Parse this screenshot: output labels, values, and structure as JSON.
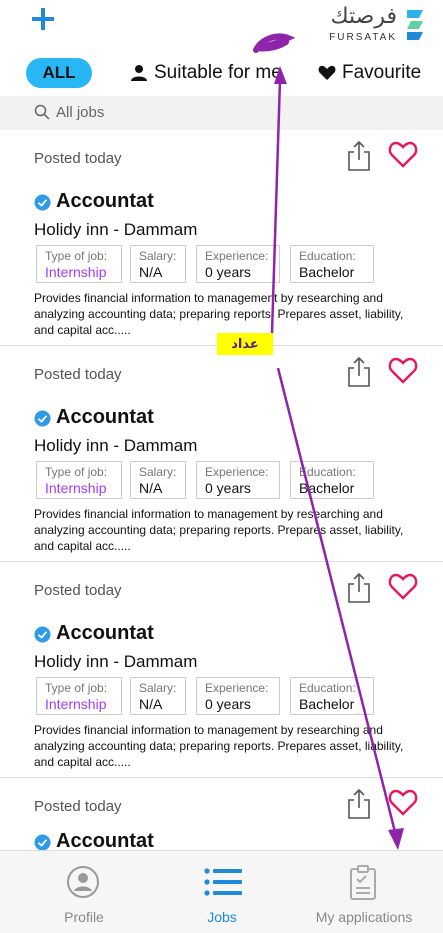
{
  "header": {
    "add_icon": "plus-icon",
    "logo_ar": "فرصتك",
    "logo_en": "FURSATAK"
  },
  "tabs": {
    "all_label": "ALL",
    "suitable_label": "Suitable for me",
    "favourite_label": "Favourite"
  },
  "search": {
    "placeholder": "All jobs"
  },
  "annotation": {
    "label": "عداد",
    "color": "#8e24aa"
  },
  "jobs": [
    {
      "posted": "Posted today",
      "title": "Accountat",
      "company": "Holidy inn - Dammam",
      "type_label": "Type of job:",
      "type_value": "Internship",
      "salary_label": "Salary:",
      "salary_value": "N/A",
      "experience_label": "Experience:",
      "experience_value": "0 years",
      "education_label": "Education:",
      "education_value": "Bachelor",
      "description": "Provides financial information to management by researching and analyzing accounting data; preparing reports. Prepares asset, liability, and capital acc....."
    },
    {
      "posted": "Posted today",
      "title": "Accountat",
      "company": "Holidy inn - Dammam",
      "type_label": "Type of job:",
      "type_value": "Internship",
      "salary_label": "Salary:",
      "salary_value": "N/A",
      "experience_label": "Experience:",
      "experience_value": "0 years",
      "education_label": "Education:",
      "education_value": "Bachelor",
      "description": "Provides financial information to management by researching and analyzing accounting data; preparing reports. Prepares asset, liability, and capital acc....."
    },
    {
      "posted": "Posted today",
      "title": "Accountat",
      "company": "Holidy inn - Dammam",
      "type_label": "Type of job:",
      "type_value": "Internship",
      "salary_label": "Salary:",
      "salary_value": "N/A",
      "experience_label": "Experience:",
      "experience_value": "0 years",
      "education_label": "Education:",
      "education_value": "Bachelor",
      "description": "Provides financial information to management by researching and analyzing accounting data; preparing reports. Prepares asset, liability, and capital acc....."
    },
    {
      "posted": "Posted today",
      "title": "Accountat"
    }
  ],
  "bottom_nav": {
    "profile_label": "Profile",
    "jobs_label": "Jobs",
    "applications_label": "My applications"
  },
  "colors": {
    "accent": "#1e8ad8",
    "tab_active": "#29b6f6",
    "heart": "#e8185c",
    "job_type": "#a23ef3",
    "verified": "#2f9be8"
  }
}
